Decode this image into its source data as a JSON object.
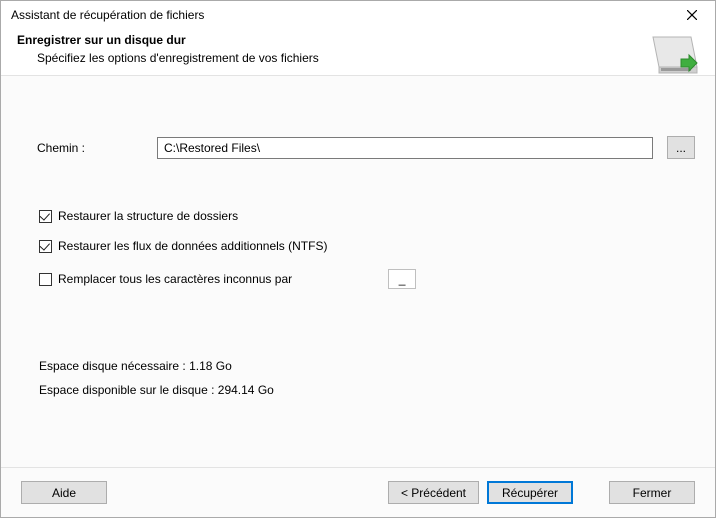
{
  "window": {
    "title": "Assistant de récupération de fichiers"
  },
  "header": {
    "title": "Enregistrer sur un disque dur",
    "subtitle": "Spécifiez les options d'enregistrement de vos fichiers"
  },
  "path": {
    "label": "Chemin :",
    "value": "C:\\Restored Files\\",
    "browse_label": "..."
  },
  "options": {
    "restore_structure": {
      "label": "Restaurer la structure de dossiers",
      "checked": true
    },
    "restore_ads": {
      "label": "Restaurer les flux de données additionnels (NTFS)",
      "checked": true
    },
    "replace_chars": {
      "label": "Remplacer tous les caractères inconnus par",
      "checked": false,
      "value": "_"
    }
  },
  "diskinfo": {
    "required": "Espace disque nécessaire : 1.18 Go",
    "available": "Espace disponible sur le disque : 294.14 Go"
  },
  "footer": {
    "help": "Aide",
    "back": "< Précédent",
    "recover": "Récupérer",
    "close": "Fermer"
  }
}
